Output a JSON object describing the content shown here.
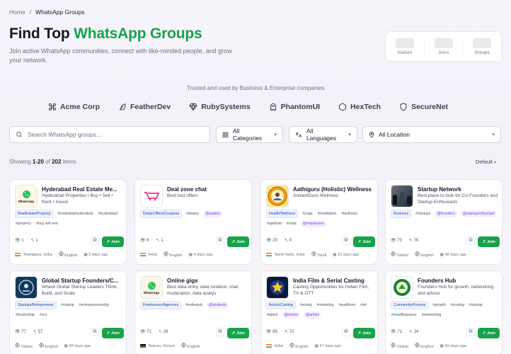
{
  "breadcrumb": {
    "home": "Home",
    "sep": "/",
    "current": "WhatsApp Groups"
  },
  "hero": {
    "title_pre": "Find Top ",
    "title_accent": "WhatsApp Groups",
    "subtitle": "Join active WhatsApp communities, connect with like-minded people, and grow your network."
  },
  "stats": [
    {
      "label": "Visitors"
    },
    {
      "label": "Joins"
    },
    {
      "label": "Groups"
    }
  ],
  "trusted": {
    "text": "Trusted and used by Business & Enterprise companies",
    "logos": [
      {
        "name": "Acme Corp",
        "icon": "command-icon"
      },
      {
        "name": "FeatherDev",
        "icon": "feather-icon"
      },
      {
        "name": "RubySystems",
        "icon": "gem-icon"
      },
      {
        "name": "PhantomUI",
        "icon": "ghost-icon"
      },
      {
        "name": "HexTech",
        "icon": "hexagon-icon"
      },
      {
        "name": "SecureNet",
        "icon": "shield-icon"
      }
    ]
  },
  "filters": {
    "search_placeholder": "Search WhatsApp groups...",
    "category": "All Categories",
    "language": "All Languages",
    "location": "All Location"
  },
  "results": {
    "pre": "Showing ",
    "range": "1-20",
    "mid": " of ",
    "total": "202",
    "post": " items",
    "sort": "Default"
  },
  "accent": "#16a34a",
  "cards": [
    {
      "title": "Hyderabad Real Estate Me...",
      "desc": "Hyderabad Properties | Buy • Sell • Rent • Invest",
      "category": "RealEstate/Property",
      "tags": [
        {
          "t": "#realestatehyderabad"
        },
        {
          "t": "#hyderabad"
        },
        {
          "t": "#property"
        },
        {
          "t": "#buy sell rent"
        }
      ],
      "m1": "1",
      "m2": "1",
      "location": "Telangana, India",
      "language": "English",
      "time": "2 days ago",
      "join": "Join",
      "img": "wa"
    },
    {
      "title": "Deal zone chat",
      "desc": "Best loot offers",
      "category": "Deals/Offers/Coupons",
      "tags": [
        {
          "t": "#stepey"
        },
        {
          "t": "@zaders",
          "p": true
        }
      ],
      "m1": "6",
      "m2": "1",
      "location": "India",
      "language": "English",
      "time": "4 days ago",
      "join": "Join",
      "img": "deal"
    },
    {
      "title": "Aathiguru (Holistic) Wellness",
      "desc": "AncientGuru Wellness",
      "category": "Health/Wellness",
      "tags": [
        {
          "t": "#yoga"
        },
        {
          "t": "#meditation"
        },
        {
          "t": "#wellness"
        },
        {
          "t": "#spiritual"
        },
        {
          "t": "#india"
        },
        {
          "t": "@employees",
          "p": true
        }
      ],
      "m1": "20",
      "m2": "0",
      "location": "Tamil Nadu, India",
      "language": "Tamil",
      "time": "15 days ago",
      "join": "Join",
      "img": "guru"
    },
    {
      "title": "Startup Network",
      "desc": "Best place to look for Co-Founders and Startup Enthusiasts",
      "category": "Business",
      "tags": [
        {
          "t": "#startups"
        },
        {
          "t": "@founders",
          "p": true
        },
        {
          "t": "@startupenthusiast",
          "p": true
        }
      ],
      "m1": "70",
      "m2": "76",
      "location": "Global",
      "language": "English",
      "time": "48 days ago",
      "join": "Join",
      "img": "photo"
    },
    {
      "title": "Global Startup Founders/C...",
      "desc": "Where Global Startup Leaders Think, Build, and Scale",
      "category": "Startups/Entrepreneur",
      "tags": [
        {
          "t": "#startup"
        },
        {
          "t": "#entrepreneurship"
        },
        {
          "t": "#leadership"
        },
        {
          "t": "#vcs"
        }
      ],
      "m1": "77",
      "m2": "57",
      "location": "Global",
      "language": "English",
      "time": "58 days ago",
      "join": "Join",
      "img": "globe"
    },
    {
      "title": "Online gigs",
      "desc": "Best data entry, data notation, chat moderation, data analys",
      "category": "Freelancers/Agencies",
      "tags": [
        {
          "t": "#onlinejob"
        },
        {
          "t": "@students",
          "p": true
        }
      ],
      "m1": "71",
      "m2": "28",
      "location": "Nakuru, Kenya",
      "language": "English",
      "time": "",
      "join": "Join",
      "img": "wa"
    },
    {
      "title": "India Film & Serial Casting",
      "desc": "Casting Opportunities for Indian Film, TV & OTT",
      "category": "Actors/Casting",
      "tags": [
        {
          "t": "#acting"
        },
        {
          "t": "#modeling"
        },
        {
          "t": "#auditions"
        },
        {
          "t": "#ott"
        },
        {
          "t": "#talent"
        },
        {
          "t": "@actors",
          "p": true
        },
        {
          "t": "@artists",
          "p": true
        }
      ],
      "m1": "85",
      "m2": "72",
      "location": "India",
      "language": "English",
      "time": "57 days ago",
      "join": "Join",
      "img": "film"
    },
    {
      "title": "Founders Hub",
      "desc": "Founders Hub for growth, networking, and advice",
      "category": "Community/Forums",
      "tags": [
        {
          "t": "#growth"
        },
        {
          "t": "#scaling"
        },
        {
          "t": "#startup"
        },
        {
          "t": "#smallbusiness"
        },
        {
          "t": "#networking"
        }
      ],
      "m1": "71",
      "m2": "24",
      "location": "Global",
      "language": "English",
      "time": "59 days ago",
      "join": "Join",
      "img": "seal"
    }
  ]
}
